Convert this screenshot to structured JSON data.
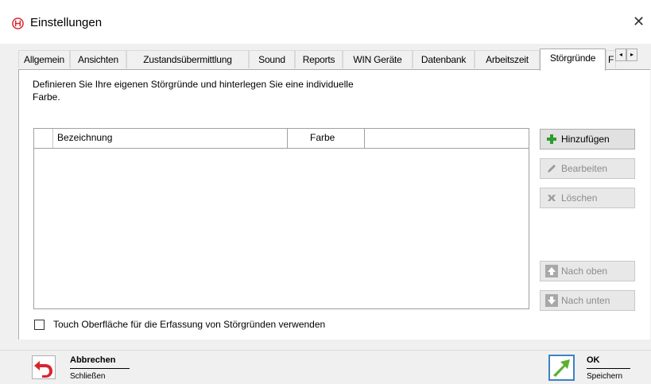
{
  "window": {
    "title": "Einstellungen",
    "close_glyph": "✕"
  },
  "tabs": [
    {
      "label": "Allgemein"
    },
    {
      "label": "Ansichten"
    },
    {
      "label": "Zustandsübermittlung"
    },
    {
      "label": "Sound"
    },
    {
      "label": "Reports"
    },
    {
      "label": "WIN Geräte"
    },
    {
      "label": "Datenbank"
    },
    {
      "label": "Arbeitszeit"
    },
    {
      "label": "Störgründe",
      "active": true
    },
    {
      "label": "F"
    }
  ],
  "tab_scroll": {
    "left": "◂",
    "right": "▸"
  },
  "panel": {
    "description_line1": "Definieren Sie Ihre eigenen Störgründe und hinterlegen Sie eine individuelle",
    "description_line2": "Farbe.",
    "grid": {
      "columns": [
        "Bezeichnung",
        "Farbe"
      ],
      "rows": []
    },
    "buttons": {
      "add": "Hinzufügen",
      "edit": "Bearbeiten",
      "delete": "Löschen",
      "up": "Nach oben",
      "down": "Nach unten"
    },
    "touch_checkbox": {
      "label": "Touch Oberfläche für die Erfassung von Störgründen verwenden",
      "checked": false
    }
  },
  "footer": {
    "cancel": {
      "title": "Abbrechen",
      "subtitle": "Schließen"
    },
    "ok": {
      "title": "OK",
      "subtitle": "Speichern"
    }
  },
  "colors": {
    "accent": "#3d82c4",
    "add_icon": "#2e9b2e",
    "cancel_icon": "#d9262b",
    "ok_icon": "#5cb030"
  },
  "icons": [
    "app-logo-icon",
    "close-icon",
    "plus-icon",
    "pencil-icon",
    "delete-icon",
    "arrow-up-icon",
    "arrow-down-icon",
    "undo-icon",
    "ok-arrow-icon"
  ]
}
